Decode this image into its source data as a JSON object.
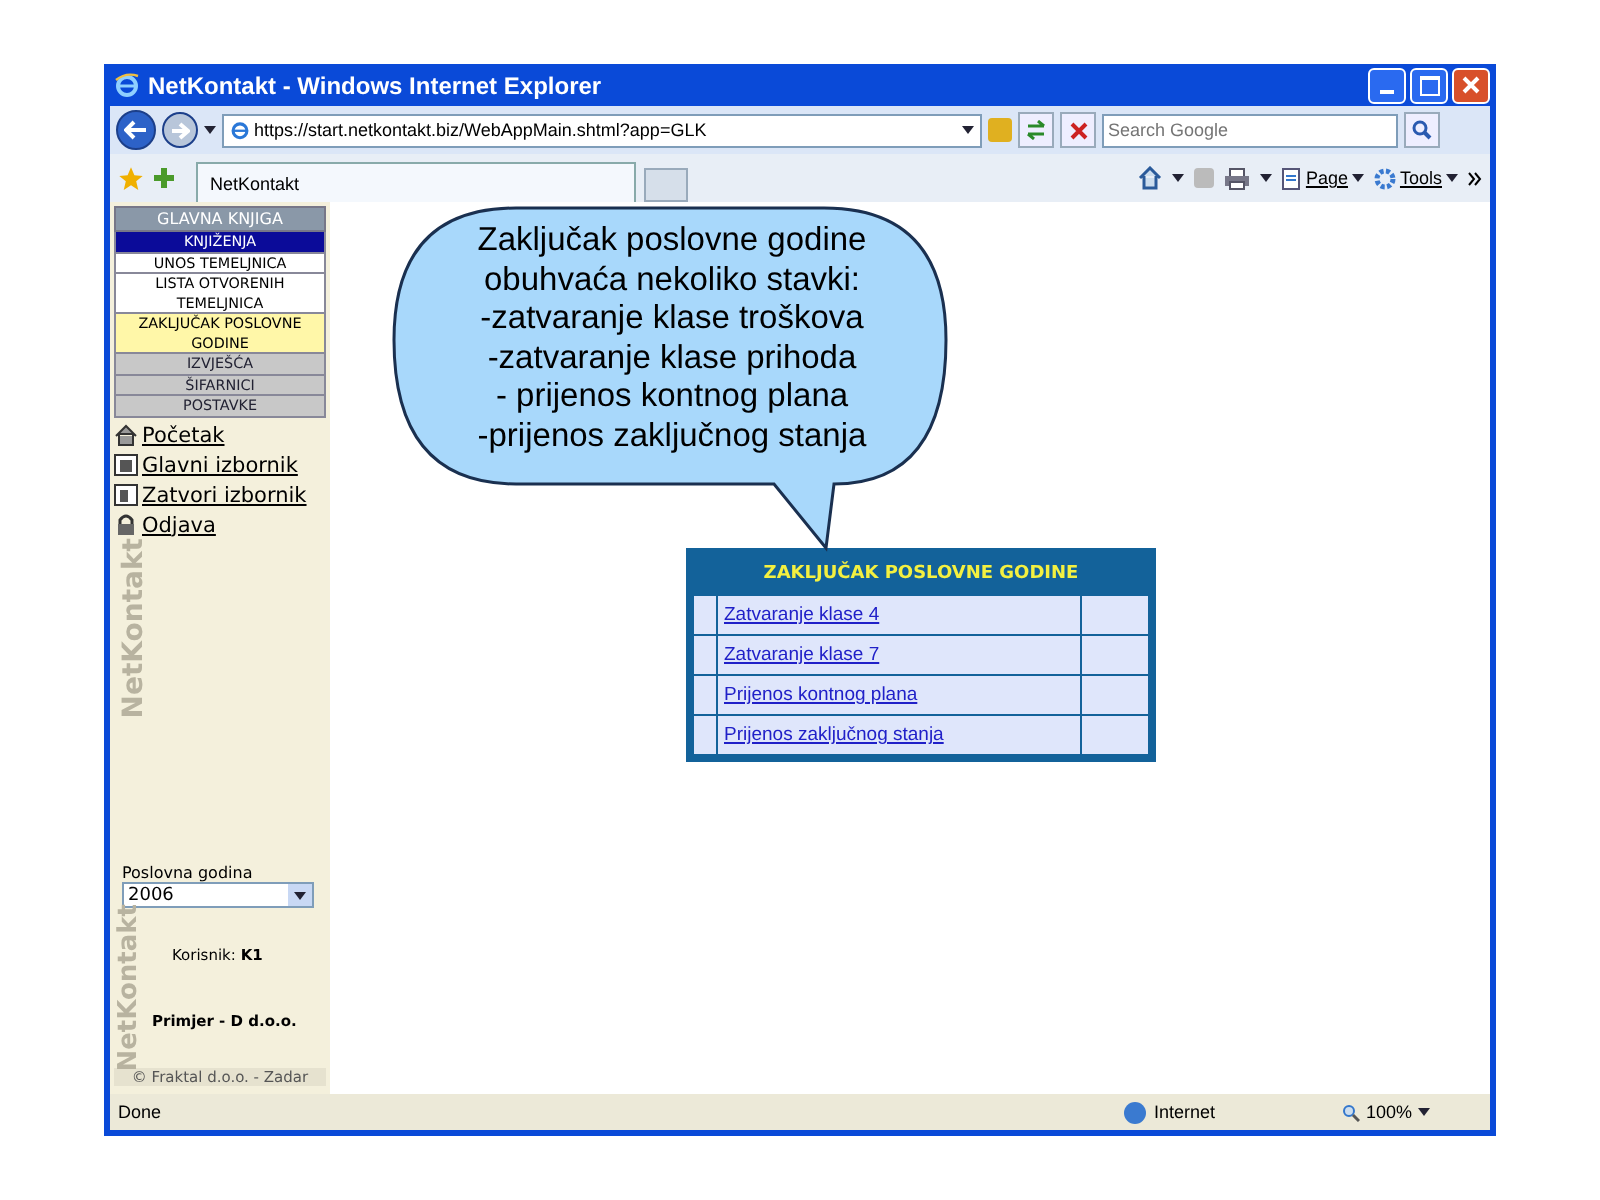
{
  "window": {
    "title": "NetKontakt - Windows Internet Explorer"
  },
  "address_bar": {
    "url": "https://start.netkontakt.biz/WebAppMain.shtml?app=GLK",
    "search_placeholder": "Search Google"
  },
  "tabs": [
    {
      "label": "NetKontakt",
      "selected": true
    }
  ],
  "command_bar": [
    {
      "label": "Page",
      "kind": "page"
    },
    {
      "label": "Tools",
      "kind": "tools"
    }
  ],
  "sidebar": {
    "header": "GLAVNA KNJIGA",
    "menu": [
      {
        "label": "KNJIŽENJA",
        "kind": "section",
        "selected": true
      },
      {
        "label": "UNOS TEMELJNICA",
        "kind": "item",
        "selected": false
      },
      {
        "label": "LISTA OTVORENIH TEMELJNICA",
        "kind": "item",
        "selected": false
      },
      {
        "label": "ZAKLJUČAK POSLOVNE GODINE",
        "kind": "item",
        "selected": true
      },
      {
        "label": "IZVJEŠĆA",
        "kind": "section",
        "selected": false
      },
      {
        "label": "ŠIFARNICI",
        "kind": "section",
        "selected": false
      },
      {
        "label": "POSTAVKE",
        "kind": "section",
        "selected": false
      }
    ],
    "links": [
      {
        "label": "Početak",
        "kind": "home"
      },
      {
        "label": "Glavni izbornik",
        "kind": "main"
      },
      {
        "label": "Zatvori izbornik",
        "kind": "close"
      },
      {
        "label": "Odjava",
        "kind": "logout"
      }
    ],
    "logo_top": "NetKontakt",
    "year_label": "Poslovna godina",
    "year_value": "2006",
    "logo_bottom": "NetKontakt",
    "user_label": "Korisnik:",
    "user_value": "K1",
    "company": "Primjer - D d.o.o.",
    "footer": "© Fraktal d.o.o. - Zadar"
  },
  "callout": {
    "lines": [
      "Zaključak poslovne godine",
      "obuhvaća nekoliko stavki:",
      "-zatvaranje klase troškova",
      "-zatvaranje klase prihoda",
      "- prijenos kontnog plana",
      "-prijenos zaključnog stanja"
    ]
  },
  "table": {
    "title": "ZAKLJUČAK POSLOVNE GODINE",
    "rows": [
      "Zatvaranje klase 4",
      "Zatvaranje klase 7",
      "Prijenos kontnog plana",
      "Prijenos zaključnog stanja"
    ]
  },
  "status_bar": {
    "text": "Done",
    "zone": "Internet",
    "zoom": "100%"
  }
}
